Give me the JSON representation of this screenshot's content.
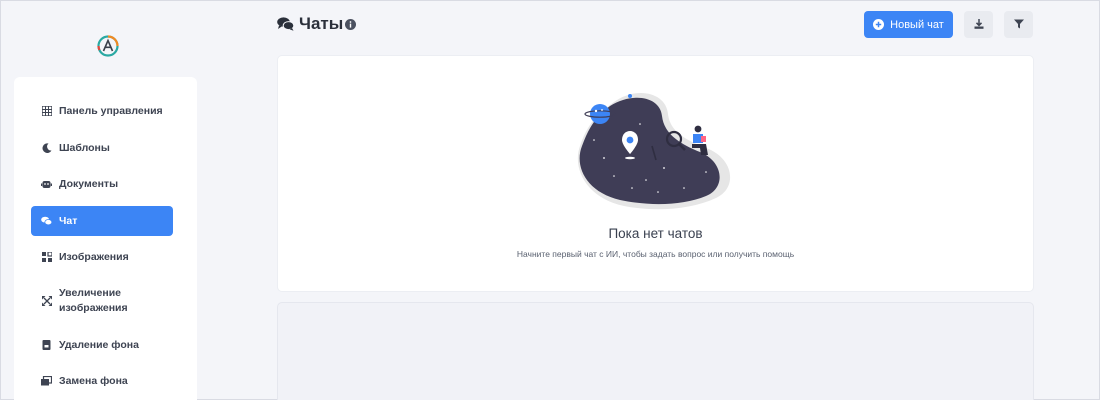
{
  "header": {
    "title": "Чаты",
    "new_chat_label": "Новый чат"
  },
  "sidebar": {
    "items": [
      {
        "label": "Панель управления",
        "icon": "grid-icon"
      },
      {
        "label": "Шаблоны",
        "icon": "moon-icon"
      },
      {
        "label": "Документы",
        "icon": "robot-icon"
      },
      {
        "label": "Чат",
        "icon": "chat-icon",
        "active": true
      },
      {
        "label": "Изображения",
        "icon": "images-icon"
      },
      {
        "label": "Увеличение изображения",
        "label_line1": "Увеличение",
        "label_line2": "изображения",
        "icon": "expand-icon"
      },
      {
        "label": "Удаление фона",
        "icon": "file-icon"
      },
      {
        "label": "Замена фона",
        "icon": "photos-icon"
      }
    ]
  },
  "empty_state": {
    "title": "Пока нет чатов",
    "subtitle": "Начните первый чат с ИИ, чтобы задать вопрос или получить помощь"
  },
  "colors": {
    "accent": "#3c85f5",
    "background": "#f4f5f9",
    "card": "#ffffff",
    "illustration_dark": "#3f3d56"
  }
}
